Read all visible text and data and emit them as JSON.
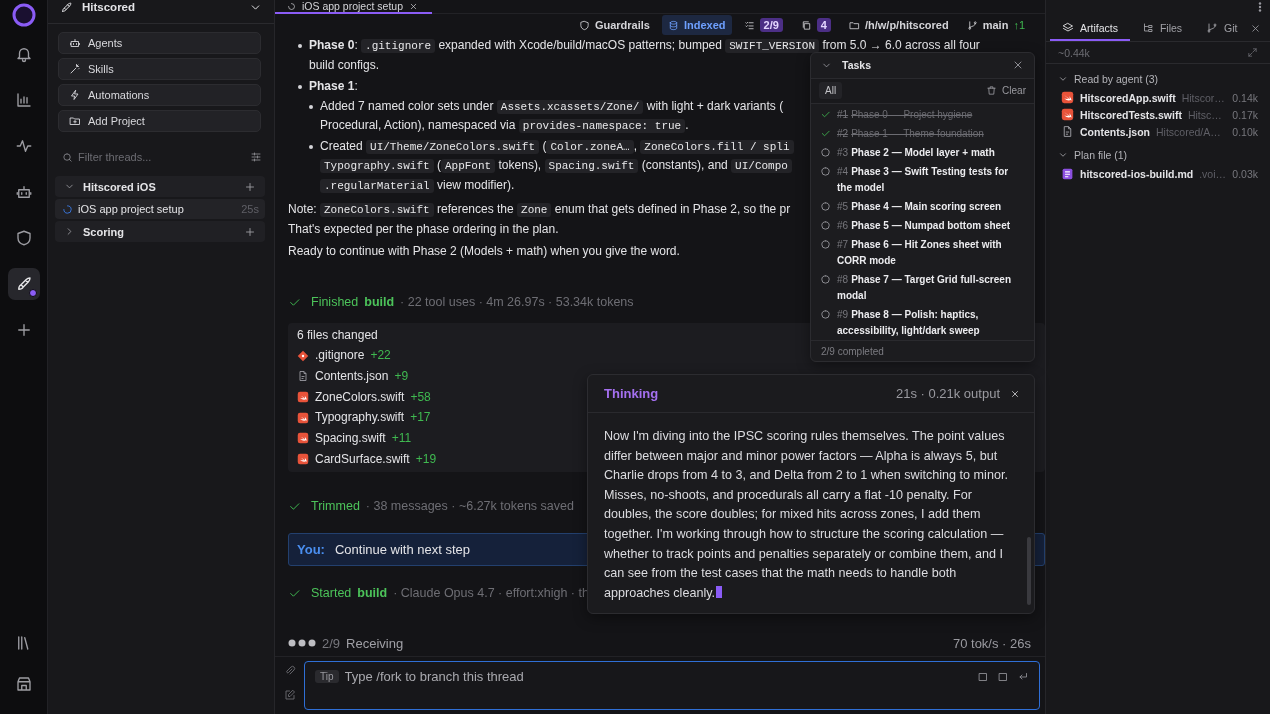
{
  "rail": {
    "top": [
      {
        "selected": false
      },
      {
        "selected": false
      },
      {
        "selected": false
      },
      {
        "selected": false
      },
      {
        "selected": false
      },
      {
        "selected": true
      },
      {
        "selected": false
      }
    ],
    "bottom": [
      {
        "selected": false
      },
      {
        "selected": false
      }
    ]
  },
  "sidebar": {
    "project": "Hitscored",
    "actions": [
      "Agents",
      "Skills",
      "Automations",
      "Add Project"
    ],
    "filter": {
      "placeholder": "Filter threads..."
    },
    "tree": [
      {
        "label": "Hitscored iOS",
        "expanded": true,
        "children": [
          {
            "label": "iOS app project setup",
            "time": "25s",
            "selected": true
          }
        ]
      },
      {
        "label": "Scoring",
        "expanded": false
      }
    ]
  },
  "tab": {
    "label": "iOS app project setup",
    "selected": true
  },
  "toolbar": [
    {
      "label": "Guardrails",
      "kind": "plain"
    },
    {
      "label": "Indexed",
      "kind": "highlight"
    },
    {
      "label": "2/9",
      "kind": "badge"
    },
    {
      "label": "4",
      "kind": "badge"
    },
    {
      "label": "/h/w/p/hitscored",
      "kind": "plain"
    },
    {
      "label": "main",
      "kind": "plain",
      "ahead": "↑1"
    }
  ],
  "message": {
    "blocks": [
      {
        "kind": "bullet",
        "lines": [
          [
            {
              "kind": "bold",
              "text": "Phase 0"
            },
            {
              "kind": "text",
              "text": ": "
            },
            {
              "kind": "code",
              "text": ".gitignore"
            },
            {
              "kind": "text",
              "text": " expanded with Xcode/build/macOS patterns; bumped "
            },
            {
              "kind": "code",
              "text": "SWIFT_VERSION"
            },
            {
              "kind": "text",
              "text": " from 5.0 → 6.0 across all four"
            }
          ],
          [
            {
              "kind": "text",
              "text": "build configs."
            }
          ]
        ]
      },
      {
        "kind": "bullet",
        "lines": [
          [
            {
              "kind": "bold",
              "text": "Phase 1"
            },
            {
              "kind": "text",
              "text": ":"
            }
          ]
        ],
        "children": [
          {
            "kind": "bullet",
            "lines": [
              [
                {
                  "kind": "text",
                  "text": "Added 7 named color sets under "
                },
                {
                  "kind": "code",
                  "text": "Assets.xcassets/Zone/"
                },
                {
                  "kind": "text",
                  "text": " with light + dark variants ("
                }
              ],
              [
                {
                  "kind": "text",
                  "text": "Procedural, Action), namespaced via "
                },
                {
                  "kind": "code",
                  "text": "provides-namespace: true"
                },
                {
                  "kind": "text",
                  "text": "."
                }
              ]
            ]
          },
          {
            "kind": "bullet",
            "lines": [
              [
                {
                  "kind": "text",
                  "text": "Created "
                },
                {
                  "kind": "code",
                  "text": "UI/Theme/ZoneColors.swift"
                },
                {
                  "kind": "text",
                  "text": " ("
                },
                {
                  "kind": "code",
                  "text": "Color.zoneA…"
                },
                {
                  "kind": "text",
                  "text": ", "
                },
                {
                  "kind": "code",
                  "text": "ZoneColors.fill / spli"
                }
              ],
              [
                {
                  "kind": "code",
                  "text": "Typography.swift"
                },
                {
                  "kind": "text",
                  "text": " ("
                },
                {
                  "kind": "code",
                  "text": "AppFont"
                },
                {
                  "kind": "text",
                  "text": " tokens), "
                },
                {
                  "kind": "code",
                  "text": "Spacing.swift"
                },
                {
                  "kind": "text",
                  "text": " (constants), and "
                },
                {
                  "kind": "code",
                  "text": "UI/Compo"
                }
              ],
              [
                {
                  "kind": "code",
                  "text": ".regularMaterial"
                },
                {
                  "kind": "text",
                  "text": " view modifier)."
                }
              ]
            ]
          }
        ]
      },
      {
        "kind": "paragraph",
        "lines": [
          [
            {
              "kind": "text",
              "text": "Note: "
            },
            {
              "kind": "code",
              "text": "ZoneColors.swift"
            },
            {
              "kind": "text",
              "text": " references the "
            },
            {
              "kind": "code",
              "text": "Zone"
            },
            {
              "kind": "text",
              "text": " enum that gets defined in Phase 2, so the pr"
            }
          ],
          [
            {
              "kind": "text",
              "text": "That's expected per the phase ordering in the plan."
            }
          ]
        ]
      },
      {
        "kind": "paragraph",
        "lines": [
          [
            {
              "kind": "text",
              "text": "Ready to continue with Phase 2 (Models + math) when you give the word."
            }
          ]
        ]
      }
    ]
  },
  "events": [
    {
      "kind": "status",
      "verb": "Finished",
      "target": "build",
      "detail": "· 22 tool uses · 4m 26.97s · 53.34k tokens"
    },
    {
      "kind": "files",
      "title": "6 files changed",
      "files": [
        {
          "name": ".gitignore",
          "added": "+22",
          "kind": "git"
        },
        {
          "name": "Contents.json",
          "added": "+9",
          "kind": "json"
        },
        {
          "name": "ZoneColors.swift",
          "added": "+58",
          "kind": "swift"
        },
        {
          "name": "Typography.swift",
          "added": "+17",
          "kind": "swift"
        },
        {
          "name": "Spacing.swift",
          "added": "+11",
          "kind": "swift"
        },
        {
          "name": "CardSurface.swift",
          "added": "+19",
          "kind": "swift"
        }
      ]
    },
    {
      "kind": "status",
      "verb": "Trimmed",
      "detail": "· 38 messages · ~6.27k tokens saved"
    },
    {
      "kind": "user",
      "who": "You:",
      "text": "Continue with next step"
    },
    {
      "kind": "status",
      "verb": "Started",
      "target": "build",
      "detail": "· Claude Opus 4.7 · effort:xhigh · th"
    }
  ],
  "progress": {
    "step": "2/9",
    "label": "Receiving",
    "rate": "70 tok/s · 26s"
  },
  "composer": {
    "tip": "Tip",
    "placeholder": "Type /fork to branch this thread"
  },
  "tasks": {
    "title": "Tasks",
    "filter": "All",
    "clear": "Clear",
    "footer": "2/9 completed",
    "items": [
      {
        "number": "#1",
        "title": "Phase 0 — Project hygiene",
        "done": true
      },
      {
        "number": "#2",
        "title": "Phase 1 — Theme foundation",
        "done": true
      },
      {
        "number": "#3",
        "title": "Phase 2 — Model layer + math",
        "done": false
      },
      {
        "number": "#4",
        "title": "Phase 3 — Swift Testing tests for the model",
        "done": false
      },
      {
        "number": "#5",
        "title": "Phase 4 — Main scoring screen",
        "done": false
      },
      {
        "number": "#6",
        "title": "Phase 5 — Numpad bottom sheet",
        "done": false
      },
      {
        "number": "#7",
        "title": "Phase 6 — Hit Zones sheet with CORR mode",
        "done": false
      },
      {
        "number": "#8",
        "title": "Phase 7 — Target Grid full-screen modal",
        "done": false
      },
      {
        "number": "#9",
        "title": "Phase 8 — Polish: haptics, accessibility, light/dark sweep",
        "done": false
      }
    ]
  },
  "thinking": {
    "title": "Thinking",
    "meta": "21s · 0.21k output",
    "text": "Now I'm diving into the IPSC scoring rules themselves. The point values differ between major and minor power factors — Alpha is always 5, but Charlie drops from 4 to 3, and Delta from 2 to 1 when switching to minor. Misses, no-shoots, and procedurals all carry a flat -10 penalty. For doubles, the score doubles; for mixed hits across zones, I add them together. I'm working through how to structure the scoring calculation — whether to track points and penalties separately or combine them, and I can see from the test cases that the math needs to handle both approaches cleanly."
  },
  "artifacts": {
    "tabs": [
      {
        "label": "Artifacts",
        "selected": true
      },
      {
        "label": "Files",
        "selected": false
      },
      {
        "label": "Git",
        "selected": false
      }
    ],
    "size": "~0.44k",
    "sections": [
      {
        "label": "Read by agent (3)",
        "expanded": true,
        "children": [
          {
            "name": "HitscoredApp.swift",
            "path": "Hitscor…",
            "size": "0.14k",
            "kind": "swift"
          },
          {
            "name": "HitscoredTests.swift",
            "path": "Hitsc…",
            "size": "0.17k",
            "kind": "swift"
          },
          {
            "name": "Contents.json",
            "path": "Hitscored/A…",
            "size": "0.10k",
            "kind": "json"
          }
        ]
      },
      {
        "label": "Plan file (1)",
        "expanded": true,
        "children": [
          {
            "name": "hitscored-ios-build.md",
            "path": ".voi…",
            "size": "0.03k",
            "kind": "plan"
          }
        ]
      }
    ]
  }
}
